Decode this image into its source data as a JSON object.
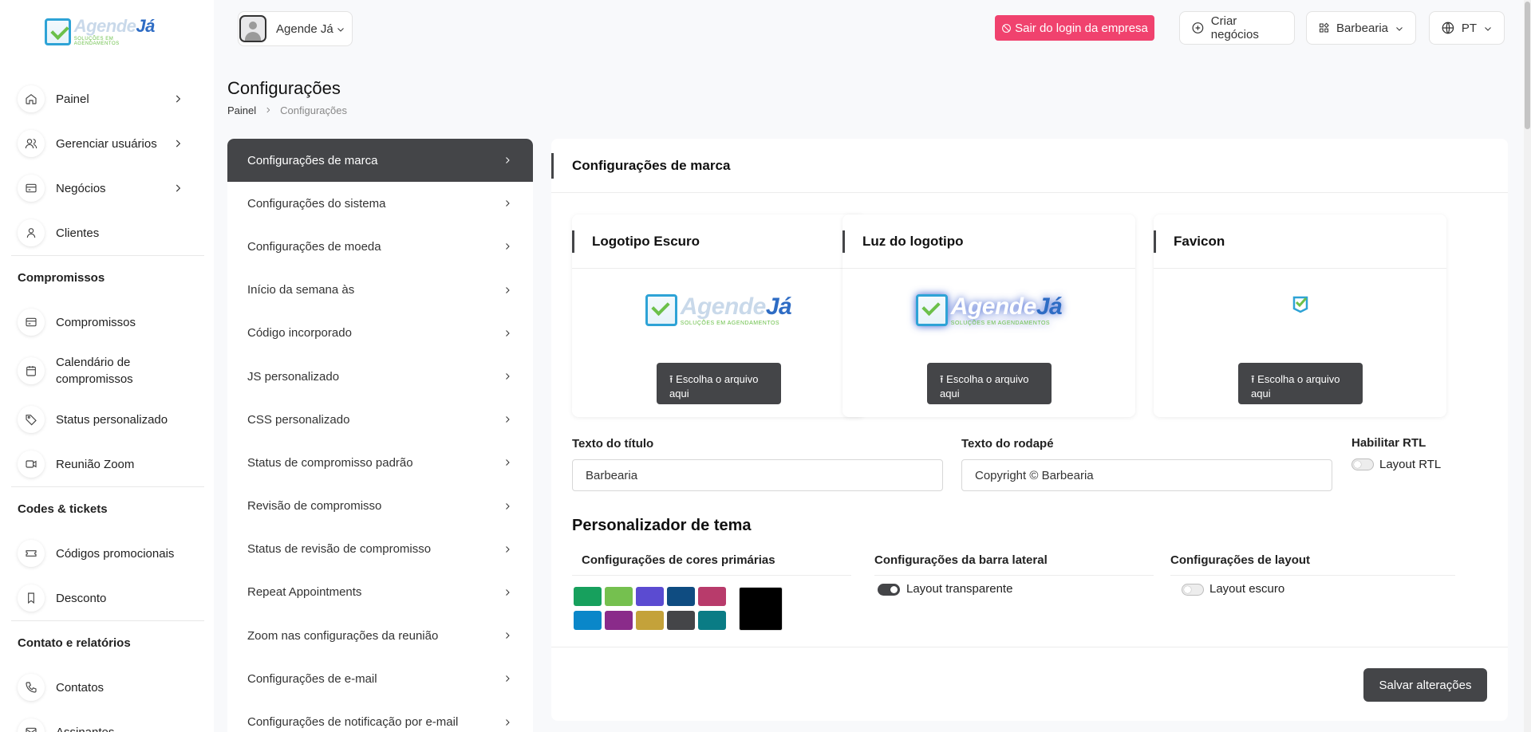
{
  "brand": {
    "logo_word_a": "Agende",
    "logo_word_b": "Já",
    "logo_sub": "SOLUÇÕES EM AGENDAMENTOS"
  },
  "topbar": {
    "user_name": "Agende Já",
    "logout_label": "Sair do login da empresa",
    "create_business_label": "Criar negócios",
    "business_select": "Barbearia",
    "language": "PT"
  },
  "sidebar": {
    "items": [
      {
        "label": "Painel",
        "icon": "home-icon",
        "chevron": true
      },
      {
        "label": "Gerenciar usuários",
        "icon": "users-icon",
        "chevron": true
      },
      {
        "label": "Negócios",
        "icon": "card-icon",
        "chevron": true
      },
      {
        "label": "Clientes",
        "icon": "user-icon",
        "chevron": false
      }
    ],
    "sections": [
      {
        "title": "Compromissos",
        "items": [
          {
            "label": "Compromissos",
            "icon": "card-icon"
          },
          {
            "label": "Calendário de compromissos",
            "icon": "calendar-icon"
          },
          {
            "label": "Status personalizado",
            "icon": "tag-icon"
          },
          {
            "label": "Reunião Zoom",
            "icon": "video-icon"
          }
        ]
      },
      {
        "title": "Codes & tickets",
        "items": [
          {
            "label": "Códigos promocionais",
            "icon": "ticket-icon"
          },
          {
            "label": "Desconto",
            "icon": "bookmark-icon"
          }
        ]
      },
      {
        "title": "Contato e relatórios",
        "items": [
          {
            "label": "Contatos",
            "icon": "phone-icon"
          },
          {
            "label": "Assinantes",
            "icon": "mail-icon"
          }
        ]
      }
    ]
  },
  "page": {
    "title": "Configurações",
    "breadcrumb": [
      "Painel",
      "Configurações"
    ]
  },
  "settings_menu": [
    "Configurações de marca",
    "Configurações do sistema",
    "Configurações de moeda",
    "Início da semana às",
    "Código incorporado",
    "JS personalizado",
    "CSS personalizado",
    "Status de compromisso padrão",
    "Revisão de compromisso",
    "Status de revisão de compromisso",
    "Repeat Appointments",
    "Zoom nas configurações da reunião",
    "Configurações de e-mail",
    "Configurações de notificação por e-mail"
  ],
  "brand_settings": {
    "header": "Configurações de marca",
    "logo_cards": [
      {
        "title": "Logotipo Escuro",
        "upload_label": "Escolha o arquivo aqui"
      },
      {
        "title": "Luz do logotipo",
        "upload_label": "Escolha o arquivo aqui"
      },
      {
        "title": "Favicon",
        "upload_label": "Escolha o arquivo aqui"
      }
    ],
    "title_text_label": "Texto do título",
    "title_text_value": "Barbearia",
    "footer_text_label": "Texto do rodapé",
    "footer_text_value": "Copyright © Barbearia",
    "rtl_label": "Habilitar RTL",
    "rtl_toggle_label": "Layout RTL",
    "rtl_enabled": false,
    "theme_title": "Personalizador de tema",
    "primary_colors_label": "Configurações de cores primárias",
    "sidebar_settings_label": "Configurações da barra lateral",
    "transparent_layout_label": "Layout transparente",
    "transparent_layout_enabled": true,
    "layout_settings_label": "Configurações de layout",
    "dark_layout_label": "Layout escuro",
    "dark_layout_enabled": false,
    "colors": [
      "#17a05d",
      "#75c04f",
      "#5b4bd1",
      "#0f4c81",
      "#b83b6b",
      "#0a87c9",
      "#8a2b8a",
      "#c4a23a",
      "#444548",
      "#0a7c85"
    ],
    "selected_color": "#000000",
    "save_label": "Salvar alterações"
  }
}
